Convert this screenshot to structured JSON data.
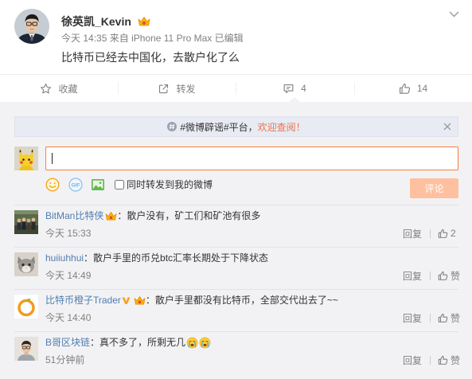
{
  "colors": {
    "accent": "#fa7d3c",
    "orange_link": "#eb7350",
    "name_blue": "#507daf",
    "text": "#333333",
    "muted": "#808080",
    "section_bg": "#f2f2f5",
    "submit_bg": "#ffc09f"
  },
  "post": {
    "author": "徐英凯_Kevin",
    "author_badges": [
      "vip-crown-icon"
    ],
    "time": "今天 14:35",
    "from_label": "来自",
    "device": "iPhone 11 Pro Max",
    "edited": "已编辑",
    "content": "比特币已经去中国化，去散户化了么",
    "menu_icon": "chevron-down-icon"
  },
  "actions": {
    "favorite": {
      "icon": "star-icon",
      "label": "收藏"
    },
    "repost": {
      "icon": "repost-icon",
      "label": "转发"
    },
    "comment": {
      "icon": "comment-icon",
      "label": "4",
      "active": true
    },
    "like": {
      "icon": "thumb-up-icon",
      "label": "14"
    }
  },
  "notice": {
    "icon": "hashtag-icon",
    "text": "#微博辟谣#平台，",
    "link": "欢迎查阅！",
    "close_icon": "close-icon"
  },
  "composer": {
    "input_value": "",
    "tools": [
      "emoji-icon",
      "gif-icon",
      "image-icon"
    ],
    "gif_text": "GIF",
    "checkbox_checked": false,
    "checkbox_label": "同时转发到我的微博",
    "submit_label": "评论"
  },
  "comments": [
    {
      "name": "BitMan比特侠",
      "badges": [
        "vip-crown-icon"
      ],
      "text": "：散户没有，矿工们和矿池有很多",
      "time": "今天 15:33",
      "reply": "回复",
      "likes": "2"
    },
    {
      "name": "huiiuhhui",
      "badges": [],
      "text": "：散户手里的币兑btc汇率长期处于下降状态",
      "time": "今天 14:49",
      "reply": "回复",
      "likes": "赞"
    },
    {
      "name": "比特币橙子Trader",
      "badges": [
        "verified-v-icon",
        "vip-crown-icon"
      ],
      "text": "：散户手里都没有比特币，全部交代出去了~~",
      "time": "今天 14:40",
      "reply": "回复",
      "likes": "赞"
    },
    {
      "name": "B哥区块链",
      "badges": [],
      "text": "：真不多了，所剩无几",
      "emoticons": [
        "crying-face-icon",
        "crying-face-icon"
      ],
      "time": "51分钟前",
      "reply": "回复",
      "likes": "赞"
    }
  ]
}
